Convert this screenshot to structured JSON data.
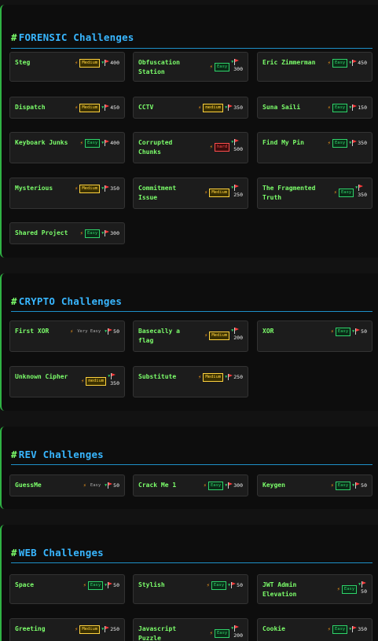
{
  "sections": [
    {
      "title": "FORENSIC Challenges",
      "cards": [
        {
          "name": "Steg",
          "difficulty": "Medium",
          "level": "medium",
          "points": "400"
        },
        {
          "name": "Obfuscation Station",
          "difficulty": "Easy",
          "level": "easy",
          "points": "300"
        },
        {
          "name": "Eric Zimmerman",
          "difficulty": "Easy",
          "level": "easy",
          "points": "450"
        },
        {
          "name": "Dispatch",
          "difficulty": "Medium",
          "level": "medium",
          "points": "450"
        },
        {
          "name": "CCTV",
          "difficulty": "medium",
          "level": "medium",
          "points": "350"
        },
        {
          "name": "Suna Saili",
          "difficulty": "Easy",
          "level": "easy",
          "points": "150"
        },
        {
          "name": "Keyboark Junks",
          "difficulty": "Easy",
          "level": "easy",
          "points": "400"
        },
        {
          "name": "Corrupted Chunks",
          "difficulty": "hard",
          "level": "hard",
          "points": "500"
        },
        {
          "name": "Find My Pin",
          "difficulty": "Easy",
          "level": "easy",
          "points": "350"
        },
        {
          "name": "Mysterious",
          "difficulty": "Medium",
          "level": "medium",
          "points": "350"
        },
        {
          "name": "Commitment Issue",
          "difficulty": "Medium",
          "level": "medium",
          "points": "250"
        },
        {
          "name": "The Fragmented Truth",
          "difficulty": "Easy",
          "level": "easy",
          "points": "350"
        },
        {
          "name": "Shared Project",
          "difficulty": "Easy",
          "level": "easy",
          "points": "300"
        }
      ]
    },
    {
      "title": "CRYPTO Challenges",
      "cards": [
        {
          "name": "First XOR",
          "difficulty": "Very Easy",
          "level": "veasy",
          "points": "50"
        },
        {
          "name": "Basecally a flag",
          "difficulty": "Medium",
          "level": "medium",
          "points": "200"
        },
        {
          "name": "XOR",
          "difficulty": "Easy",
          "level": "easy",
          "points": "50"
        },
        {
          "name": "Unknown Cipher",
          "difficulty": "medium",
          "level": "medium",
          "points": "350"
        },
        {
          "name": "Substitute",
          "difficulty": "Medium",
          "level": "medium",
          "points": "250"
        }
      ]
    },
    {
      "title": "REV Challenges",
      "cards": [
        {
          "name": "GuessMe",
          "difficulty": "Easy",
          "level": "veasy",
          "points": "50"
        },
        {
          "name": "Crack Me 1",
          "difficulty": "Easy",
          "level": "easy",
          "points": "300"
        },
        {
          "name": "Keygen",
          "difficulty": "Easy",
          "level": "easy",
          "points": "50"
        }
      ]
    },
    {
      "title": "WEB Challenges",
      "cards": [
        {
          "name": "Space",
          "difficulty": "Easy",
          "level": "easy",
          "points": "50"
        },
        {
          "name": "Stylish",
          "difficulty": "Easy",
          "level": "easy",
          "points": "50"
        },
        {
          "name": "JWT Admin Elevation",
          "difficulty": "Easy",
          "level": "easy",
          "points": "50"
        },
        {
          "name": "Greeting",
          "difficulty": "Medium",
          "level": "medium",
          "points": "250"
        },
        {
          "name": "Javascript Puzzle",
          "difficulty": "Easy",
          "level": "easy",
          "points": "200"
        },
        {
          "name": "Cookie",
          "difficulty": "Easy",
          "level": "easy",
          "points": "350"
        }
      ]
    }
  ],
  "icons": {
    "difficulty": "bolt-icon",
    "points": "flag-icon",
    "marker": "chevron-icon"
  },
  "colors": {
    "accent_blue": "#38b6ff",
    "accent_green": "#7cff6b",
    "medium": "#ffd23f",
    "easy": "#2fd36a",
    "hard": "#ff4d4d",
    "flag": "#ff3b3b"
  }
}
